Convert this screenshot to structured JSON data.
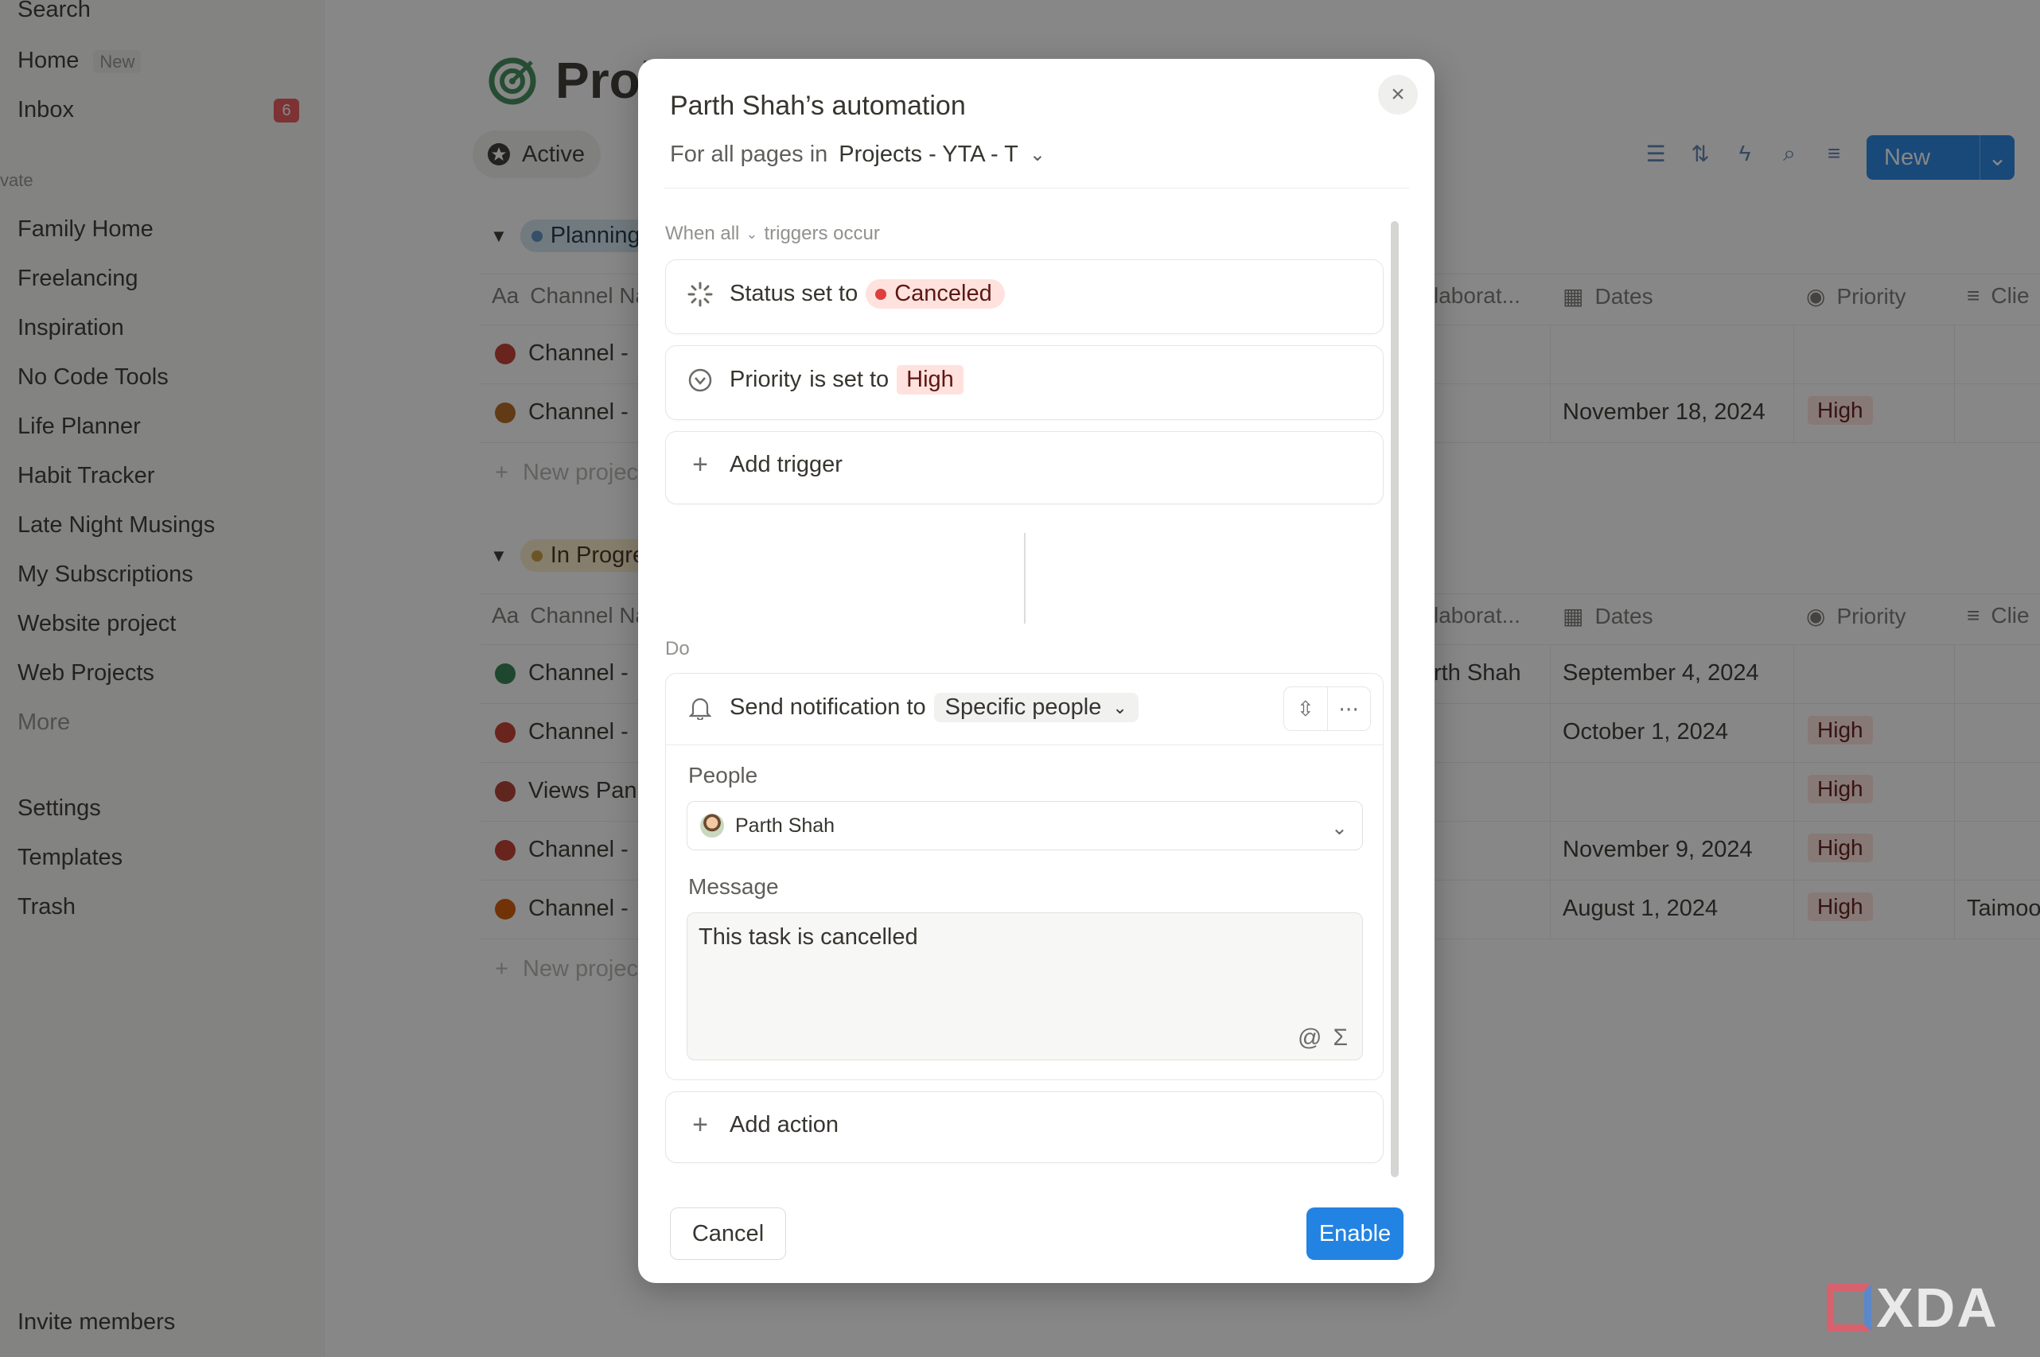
{
  "sidebar": {
    "search": "Search",
    "home": "Home",
    "home_tag": "New",
    "inbox": "Inbox",
    "inbox_count": "6",
    "section_private": "vate",
    "pages": [
      "Family Home",
      "Freelancing",
      "Inspiration",
      "No Code Tools",
      "Life Planner",
      "Habit Tracker",
      "Late Night Musings",
      "My Subscriptions",
      "Website project",
      "Web Projects"
    ],
    "more": "More",
    "settings": "Settings",
    "templates": "Templates",
    "trash": "Trash",
    "invite": "Invite members"
  },
  "page": {
    "title": "Proj",
    "view_tab": "Active",
    "new_button": "New",
    "groups": [
      {
        "name": "Planning",
        "color": "#5a8fbd",
        "columns": {
          "name": "Channel Na",
          "collab": "laborat...",
          "dates": "Dates",
          "priority": "Priority",
          "client": "Clie"
        },
        "rows": [
          {
            "name": "Channel -",
            "icon_color": "#c0392b",
            "dates": "",
            "priority": ""
          },
          {
            "name": "Channel -",
            "icon_color": "#b5651d",
            "dates": "November 18, 2024",
            "priority": "High"
          }
        ],
        "new_row": "New projec"
      },
      {
        "name": "In Progre",
        "color": "#c99a3a",
        "columns": {
          "name": "Channel Na",
          "collab": "laborat...",
          "dates": "Dates",
          "priority": "Priority",
          "client": "Clie"
        },
        "rows": [
          {
            "name": "Channel -",
            "icon_color": "#2e7d4f",
            "collab": "rth Shah",
            "dates": "September 4, 2024",
            "priority": ""
          },
          {
            "name": "Channel -",
            "icon_color": "#c0392b",
            "collab": "",
            "dates": "October 1, 2024",
            "priority": "High"
          },
          {
            "name": "Views Pan",
            "icon_color": "#b03a2e",
            "collab": "",
            "dates": "",
            "priority": "High"
          },
          {
            "name": "Channel -",
            "icon_color": "#c0392b",
            "collab": "",
            "dates": "November 9, 2024",
            "priority": "High"
          },
          {
            "name": "Channel -",
            "icon_color": "#d35400",
            "collab": "",
            "dates": "August 1, 2024",
            "priority": "High",
            "client": "Taimoo"
          }
        ],
        "new_row": "New projec"
      }
    ]
  },
  "modal": {
    "title": "Parth Shah’s automation",
    "scope_prefix": "For all pages in",
    "scope_db": "Projects - YTA - T",
    "when_prefix": "When all",
    "when_suffix": "triggers occur",
    "trigger1": {
      "label": "Status set to",
      "value": "Canceled",
      "dot_color": "#e03e3e"
    },
    "trigger2": {
      "property": "Priority",
      "label": "is set to",
      "value": "High"
    },
    "add_trigger": "Add trigger",
    "do_label": "Do",
    "action": {
      "label": "Send notification to",
      "target": "Specific people",
      "people_label": "People",
      "people_value": "Parth Shah",
      "message_label": "Message",
      "message_value": "This task is cancelled"
    },
    "add_action": "Add action",
    "cancel": "Cancel",
    "enable": "Enable"
  },
  "watermark": "XDA"
}
